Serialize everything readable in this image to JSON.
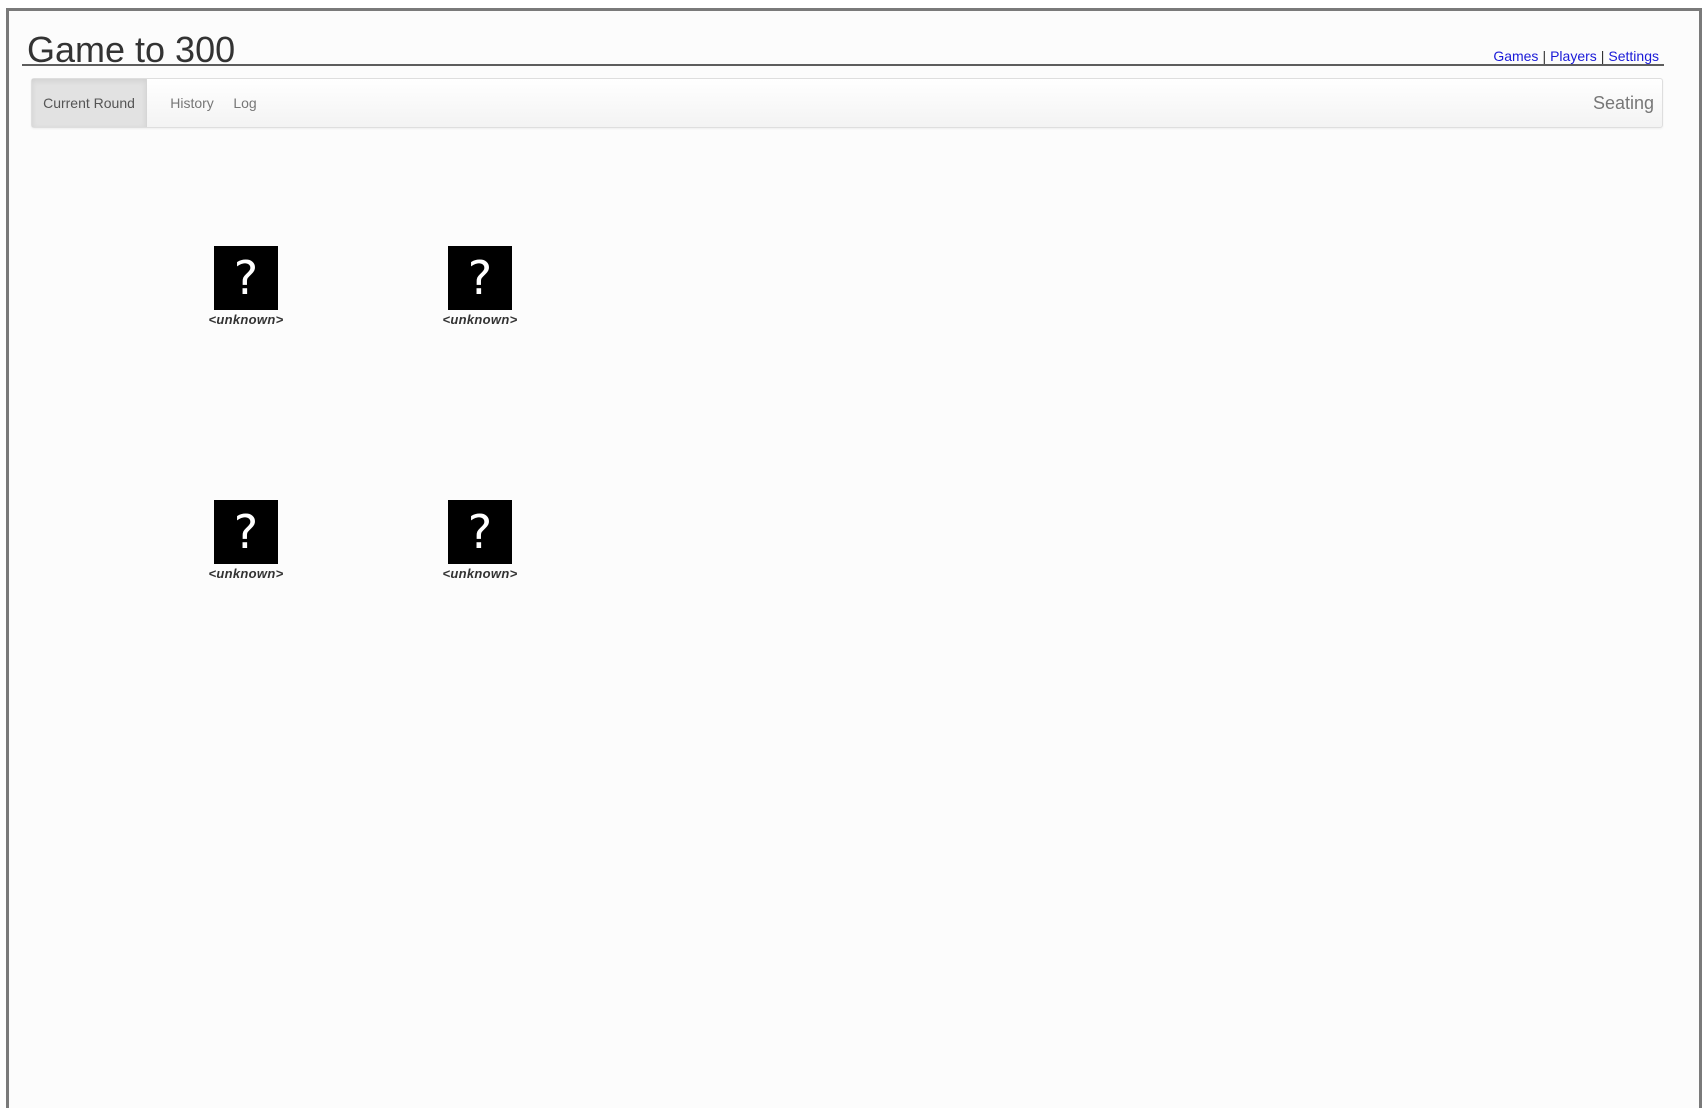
{
  "page": {
    "title": "Game to 300"
  },
  "top_links": {
    "games": "Games",
    "players": "Players",
    "settings": "Settings",
    "separator": "|"
  },
  "nav": {
    "tabs": [
      {
        "label": "Current Round",
        "active": true
      },
      {
        "label": "History",
        "active": false
      },
      {
        "label": "Log",
        "active": false
      }
    ],
    "right_label": "Seating"
  },
  "seats": [
    {
      "avatar_glyph": "?",
      "name": "<unknown>",
      "icon": "unknown-player-icon"
    },
    {
      "avatar_glyph": "?",
      "name": "<unknown>",
      "icon": "unknown-player-icon"
    },
    {
      "avatar_glyph": "?",
      "name": "<unknown>",
      "icon": "unknown-player-icon"
    },
    {
      "avatar_glyph": "?",
      "name": "<unknown>",
      "icon": "unknown-player-icon"
    }
  ],
  "colors": {
    "link": "#1a1ad8",
    "avatar_bg": "#000000",
    "active_tab_bg": "#e2e2e2"
  }
}
